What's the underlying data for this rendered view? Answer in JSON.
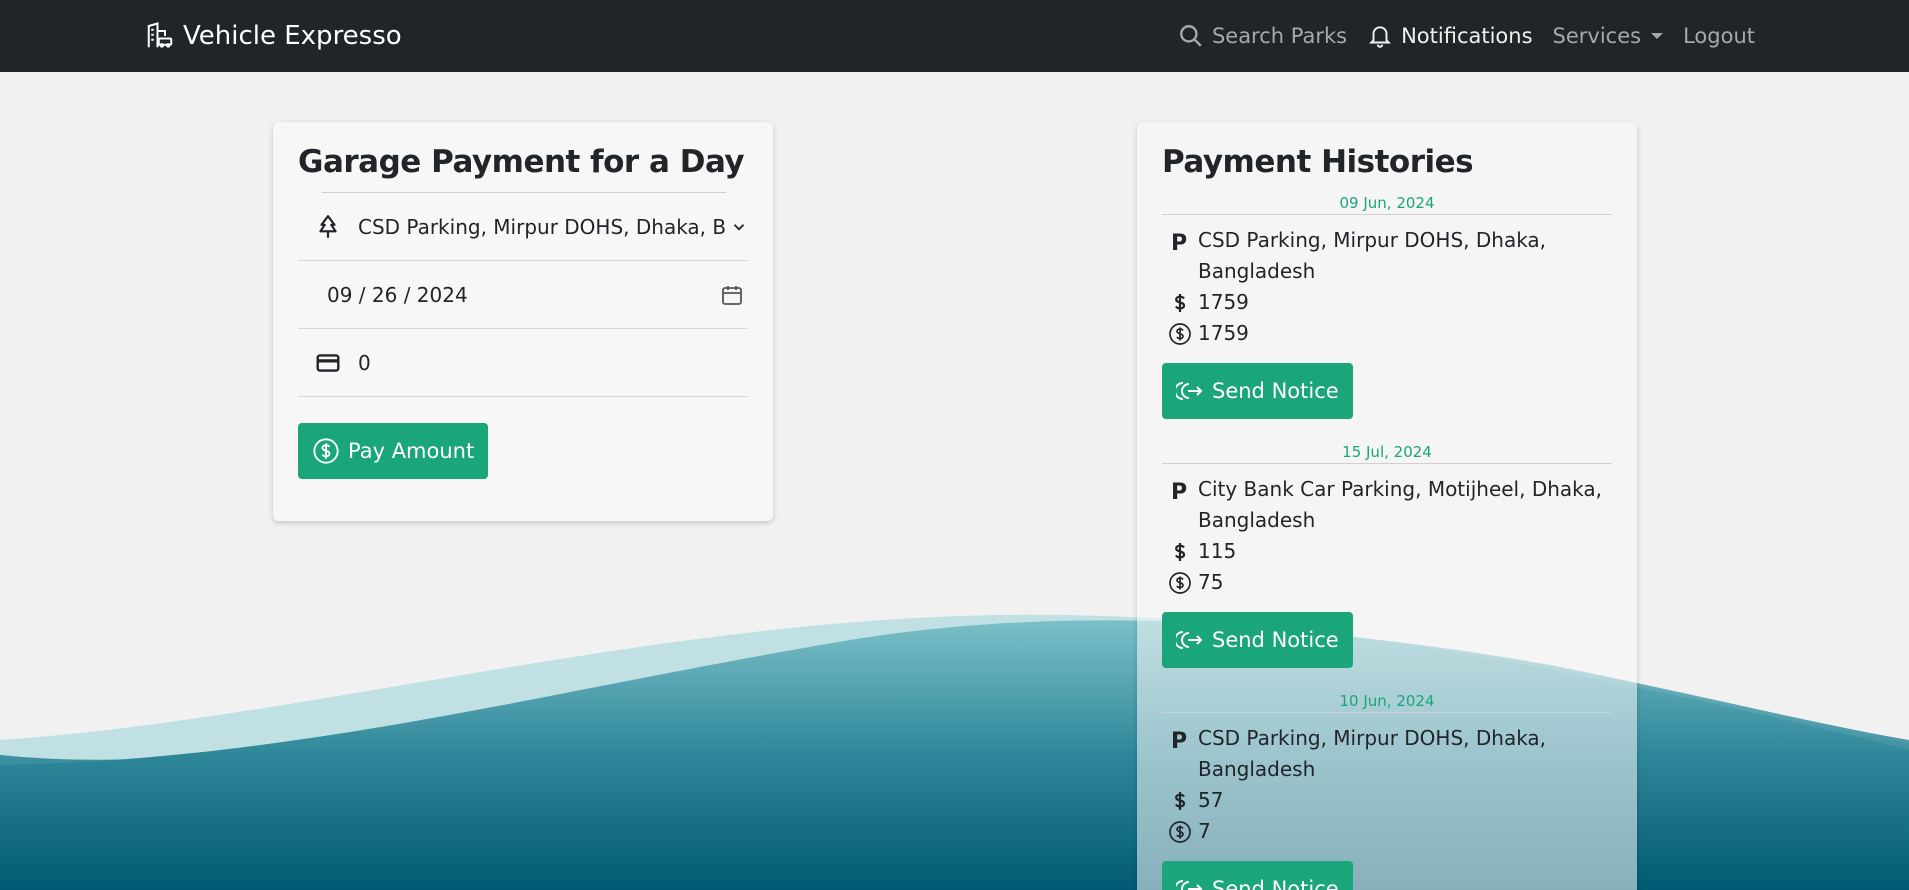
{
  "navbar": {
    "brand": "Vehicle Expresso",
    "search_label": "Search Parks",
    "notifications_label": "Notifications",
    "services_label": "Services",
    "logout_label": "Logout"
  },
  "payment_form": {
    "title": "Garage Payment for a Day",
    "garage_selected": "CSD Parking, Mirpur DOHS, Dhaka, Bangladesh",
    "date_value": "09 / 26 / 2024",
    "amount_value": "0",
    "pay_button": "Pay Amount"
  },
  "history": {
    "title": "Payment Histories",
    "send_notice_label": "Send Notice",
    "entries": [
      {
        "date": "09 Jun, 2024",
        "place": "CSD Parking, Mirpur DOHS, Dhaka, Bangladesh",
        "amount": "1759",
        "paid": "1759"
      },
      {
        "date": "15 Jul, 2024",
        "place": "City Bank Car Parking, Motijheel, Dhaka, Bangladesh",
        "amount": "115",
        "paid": "75"
      },
      {
        "date": "10 Jun, 2024",
        "place": "CSD Parking, Mirpur DOHS, Dhaka, Bangladesh",
        "amount": "57",
        "paid": "7"
      }
    ]
  },
  "colors": {
    "navbar_bg": "#212529",
    "accent_green": "#1aa57a",
    "wave_dark": "#005a73",
    "wave_light": "#8ccbd2"
  }
}
